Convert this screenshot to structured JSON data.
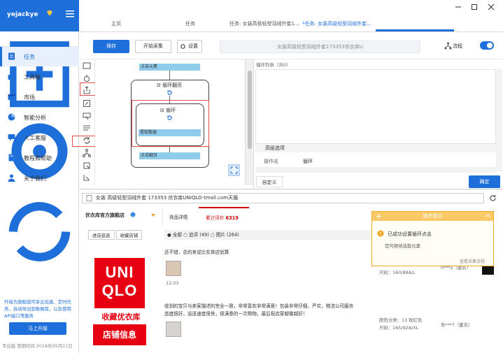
{
  "sidebar": {
    "username": "yejackye",
    "promo": "升级为旗舰版可享云加速、定时任务、自动导出到数据库，以及使用API接口等服务",
    "upgrade_label": "马上升级",
    "footer": "专业版 到期时间 2018年09月21日",
    "items": [
      {
        "label": "任务",
        "icon": "task-icon"
      },
      {
        "label": "工具箱",
        "icon": "toolbox-icon"
      },
      {
        "label": "市场",
        "icon": "market-icon"
      },
      {
        "label": "智能分析",
        "icon": "pie-chart-icon"
      },
      {
        "label": "人工客服",
        "icon": "chat-icon"
      },
      {
        "label": "教程和帮助",
        "icon": "book-icon"
      },
      {
        "label": "关于我们",
        "icon": "user-icon"
      }
    ]
  },
  "tabs": [
    "主页",
    "任务",
    "任务: 女装高极轻型羽绒外套1...",
    "*任务: 女装高级轻型羽绒外套..."
  ],
  "toolbar": {
    "save": "保存",
    "start": "开始采集",
    "settings": "设置",
    "task_name": "女装高级轻型羽绒外套173353优衣库U",
    "flow": "流程"
  },
  "flow": {
    "click_element": "点击元素",
    "loop_page": "循环翻页",
    "loop": "循环",
    "extract": "提取数据",
    "click_page": "点击翻页"
  },
  "panel": {
    "loop_list": "循环列表（共0）",
    "advanced": "高级选项",
    "op_name_label": "操作名",
    "op_name_value": "循环",
    "custom": "自定义",
    "confirm": "确定"
  },
  "browser": {
    "url": "女装 高级轻型羽绒外套 173353 优衣库UNIQLO-tmall.com天猫"
  },
  "web": {
    "shop": "优衣库官方旗舰店",
    "tab_detail": "商品详情",
    "tab_reviews": "累计评价",
    "review_count": "6319",
    "btn_enter": "进店逛逛",
    "btn_fav": "收藏店铺",
    "filter": "● 全部  ○ 追评 (49)  ○ 图片 (264)",
    "logo_top": "UNI",
    "logo_bottom": "QLO",
    "logo_fav": "收藏优衣库",
    "logo_info": "店铺信息",
    "review1": "还不错，总的来说比实体店划算",
    "date1": "12.03",
    "size1": "尺码：160/88A/L",
    "user1": "h***2（匿名）",
    "review2": "收到的宝贝与卖家描述的完全一致，非常喜欢非常满意！包装非常仔细、严实，物流公司服务",
    "review2b": "态度很好，运送速度很快，很满意的一次购物。最后祝店家越做越好！",
    "color2": "颜色分类：13 玫红色",
    "size2": "尺码：165/92A/XL",
    "user2": "朱***7（匿名）"
  },
  "popup": {
    "title": "操作提示",
    "msg1": "已成功设置循环点击",
    "msg2": "您可继续选取元素",
    "link": "查看采集流程"
  }
}
